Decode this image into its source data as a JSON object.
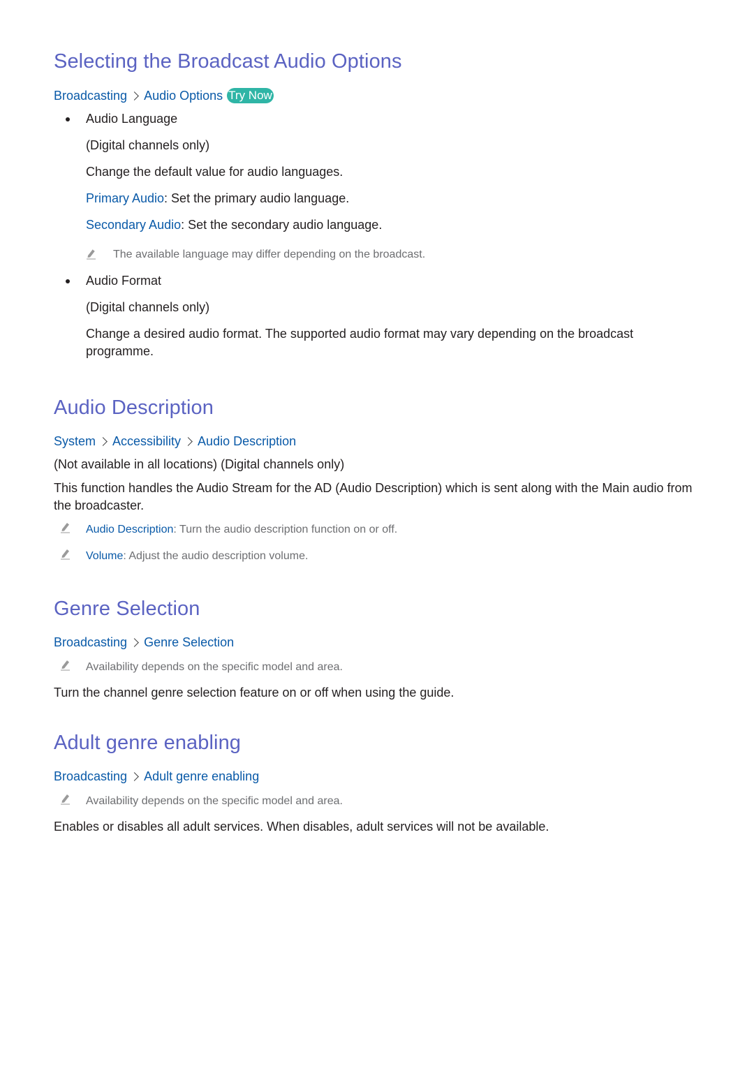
{
  "sections": [
    {
      "title": "Selecting the Broadcast Audio Options",
      "breadcrumb": [
        "Broadcasting",
        "Audio Options"
      ],
      "try_now": "Try Now",
      "bullets": [
        {
          "label": "Audio Language",
          "lines": [
            "(Digital channels only)",
            "Change the default value for audio languages."
          ],
          "options": [
            {
              "term": "Primary Audio",
              "desc": ": Set the primary audio language."
            },
            {
              "term": "Secondary Audio",
              "desc": ": Set the secondary audio language."
            }
          ],
          "note": "The available language may differ depending on the broadcast."
        },
        {
          "label": "Audio Format",
          "lines": [
            "(Digital channels only)",
            "Change a desired audio format. The supported audio format may vary depending on the broadcast programme."
          ]
        }
      ]
    },
    {
      "title": "Audio Description",
      "breadcrumb": [
        "System",
        "Accessibility",
        "Audio Description"
      ],
      "lines": [
        "(Not available in all locations) (Digital channels only)",
        "This function handles the Audio Stream for the AD (Audio Description) which is sent along with the Main audio from the broadcaster."
      ],
      "notes": [
        {
          "term": "Audio Description",
          "desc": ": Turn the audio description function on or off."
        },
        {
          "term": "Volume",
          "desc": ": Adjust the audio description volume."
        }
      ]
    },
    {
      "title": "Genre Selection",
      "breadcrumb": [
        "Broadcasting",
        "Genre Selection"
      ],
      "note": "Availability depends on the specific model and area.",
      "body": "Turn the channel genre selection feature on or off when using the guide."
    },
    {
      "title": "Adult genre enabling",
      "breadcrumb": [
        "Broadcasting",
        "Adult genre enabling"
      ],
      "note": "Availability depends on the specific model and area.",
      "body": "Enables or disables all adult services. When disables, adult services will not be available."
    }
  ],
  "colors": {
    "heading": "#5b63c2",
    "link": "#0a5aa8",
    "body": "#231f20",
    "note": "#6d6e71",
    "try_now_bg": "#2fb5a6"
  }
}
